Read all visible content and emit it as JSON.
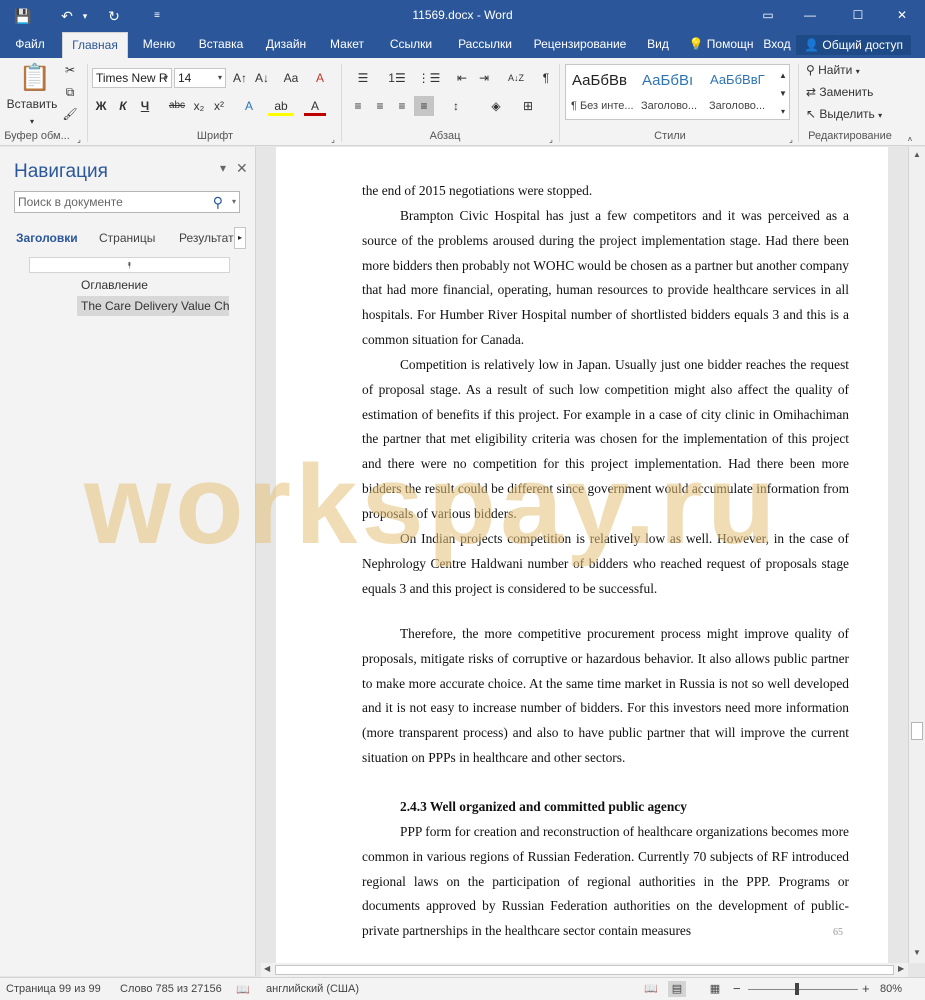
{
  "window": {
    "title": "11569.docx - Word",
    "save_icon": "💾",
    "undo_icon": "↶",
    "redo_icon": "↻",
    "customize_icon": "≡",
    "restore_icon": "▭",
    "minimize_icon": "—",
    "maximize_icon": "☐",
    "close_icon": "✕"
  },
  "tabs": [
    "Файл",
    "Главная",
    "Меню",
    "Вставка",
    "Дизайн",
    "Макет",
    "Ссылки",
    "Рассылки",
    "Рецензирование",
    "Вид"
  ],
  "tellme": "Помощн",
  "signin": "Вход",
  "share": "Общий доступ",
  "ribbon": {
    "paste_label": "Вставить",
    "font_name": "Times New R",
    "font_size": "14",
    "groups": {
      "clipboard": "Буфер обм...",
      "font": "Шрифт",
      "paragraph": "Абзац",
      "styles": "Стили",
      "editing": "Редактирование"
    },
    "font_buttons": {
      "grow": "A↑",
      "shrink": "A↓",
      "case": "Aa",
      "clear": "A",
      "bold": "Ж",
      "italic": "К",
      "underline": "Ч",
      "strike": "abc",
      "subscript": "x₂",
      "superscript": "x²",
      "effects": "A",
      "highlight": "ab",
      "color": "A"
    },
    "para_buttons": {
      "bullets": "☰",
      "numbering": "1☰",
      "multilevel": "⋮☰",
      "decrease_indent": "⇤",
      "increase_indent": "⇥",
      "sort": "A↓Z",
      "show_marks": "¶",
      "align_left": "≡",
      "align_center": "≡",
      "align_right": "≡",
      "justify": "≡",
      "line_spacing": "↕",
      "shading": "◈",
      "borders": "⊞"
    },
    "styles": [
      {
        "sample": "АаБбВв",
        "name": "¶ Без инте..."
      },
      {
        "sample": "АаБбВı",
        "name": "Заголово..."
      },
      {
        "sample": "АаБбВвГ",
        "name": "Заголово..."
      }
    ],
    "editing": {
      "find": "Найти",
      "replace": "Заменить",
      "select": "Выделить"
    }
  },
  "nav": {
    "title": "Навигация",
    "search_placeholder": "Поиск в документе",
    "tabs": [
      "Заголовки",
      "Страницы",
      "Результате"
    ],
    "headings": [
      "Оглавление",
      "The Care Delivery Value Ch..."
    ],
    "close_icon": "✕",
    "menu_icon": "▾",
    "search_icon": "⚲",
    "collapse_icon": "⯭"
  },
  "document": {
    "paragraphs": [
      "the end of 2015 negotiations were stopped.",
      "Brampton Civic Hospital has just a few competitors and it was perceived as a source of the problems aroused during the project implementation stage. Had there been more bidders then probably not WOHC would be chosen as a partner but another company that had more financial, operating, human resources to provide healthcare services in all hospitals. For Humber River Hospital number of shortlisted bidders equals 3 and this is a common situation for Canada.",
      "Competition is relatively low in Japan. Usually just one bidder reaches the request of proposal stage. As a result of such low competition might also affect the quality of estimation of benefits if this project. For example in a case of city clinic in Omihachiman the partner that met eligibility criteria was chosen for the implementation of this project and there were no competition for this project implementation. Had there been more bidders the result could be different since government would accumulate information from proposals of various bidders.",
      "On Indian projects competition is relatively low as well. However, in the case of Nephrology Centre Haldwani number of bidders who reached request of proposals stage equals 3 and this project is considered to be successful.",
      "Therefore, the more competitive procurement process might improve quality of proposals, mitigate risks of corruptive or hazardous behavior. It also allows public partner to make more accurate choice. At the same time market in Russia is not so well developed and it is not easy to increase number of bidders. For this investors need more information (more transparent process) and also to have public partner that will improve the current situation on PPPs in healthcare and other sectors.",
      "2.4.3  Well organized and committed public agency",
      "PPP form for creation and reconstruction of healthcare organizations becomes more common in various regions of Russian Federation. Currently 70 subjects of RF introduced regional laws on the participation of regional authorities in the PPP. Programs or documents approved by Russian Federation authorities on the development of public-private partnerships in the healthcare sector contain measures"
    ],
    "page_number": "65",
    "watermark": "workspay.ru"
  },
  "status": {
    "page": "Страница 99 из 99",
    "words": "Слово 785 из 27156",
    "language": "английский (США)",
    "zoom": "80%",
    "minus": "−",
    "plus": "+"
  }
}
